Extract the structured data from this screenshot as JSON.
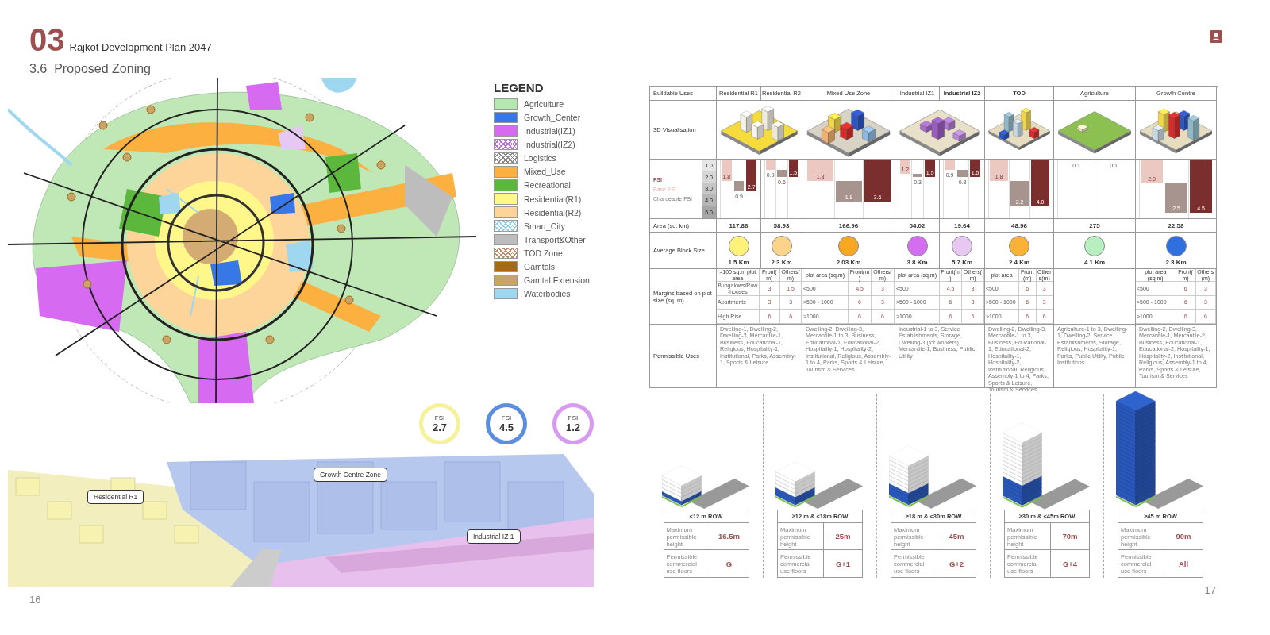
{
  "header": {
    "chapter": "03",
    "document_title": "Rajkot Development Plan 2047",
    "section_title": "3.6  Proposed Zoning"
  },
  "legend": {
    "title": "LEGEND",
    "items": [
      {
        "label": "Agriculture",
        "color": "#b5e8b0",
        "kind": "solid"
      },
      {
        "label": "Growth_Center",
        "color": "#3778e6",
        "kind": "solid"
      },
      {
        "label": "Industrial(IZ1)",
        "color": "#d66af0",
        "kind": "solid"
      },
      {
        "label": "Industrial(IZ2)",
        "color": "#c070e0",
        "kind": "hatched"
      },
      {
        "label": "Logistics",
        "color": "#888888",
        "kind": "hatched"
      },
      {
        "label": "Mixed_Use",
        "color": "#fbb040",
        "kind": "solid"
      },
      {
        "label": "Recreational",
        "color": "#5cb83c",
        "kind": "solid"
      },
      {
        "label": "Residential(R1)",
        "color": "#fff78a",
        "kind": "solid"
      },
      {
        "label": "Residential(R2)",
        "color": "#fdd59a",
        "kind": "solid"
      },
      {
        "label": "Smart_City",
        "color": "#8fd0ea",
        "kind": "hatched"
      },
      {
        "label": "Transport&Other",
        "color": "#bdbdbd",
        "kind": "solid"
      },
      {
        "label": "TOD Zone",
        "color": "#c08a6a",
        "kind": "hatched"
      },
      {
        "label": "Gamtals",
        "color": "#a86a10",
        "kind": "solid"
      },
      {
        "label": "Gamtal Extension",
        "color": "#c9a468",
        "kind": "solid"
      },
      {
        "label": "Waterbodies",
        "color": "#9fd6f0",
        "kind": "solid"
      }
    ]
  },
  "fsi_badges": [
    {
      "label": "FSI",
      "value": "2.7",
      "color": "#f5f29a"
    },
    {
      "label": "FSI",
      "value": "4.5",
      "color": "#5b8ee0"
    },
    {
      "label": "FSI",
      "value": "1.2",
      "color": "#d89af0"
    }
  ],
  "render_callouts": [
    "Residential R1",
    "Growth Centre Zone",
    "Industrial IZ 1"
  ],
  "page_numbers": [
    "16",
    "17"
  ],
  "table": {
    "row_labels": {
      "uses": "Buildable Uses",
      "visualisation": "3D Visualisation",
      "fsi": "FSI",
      "base_fsi": "Base FSI",
      "chargeable_fsi": "Chargeable FSI",
      "area": "Area (sq. km)",
      "block": "Average Block Size",
      "margins": "Margins based on plot size (sq. m)",
      "permissible": "Permissible Uses"
    },
    "fsi_scale": [
      "1.0",
      "2.0",
      "3.0",
      "4.0",
      "5.0"
    ],
    "zone_groups": [
      {
        "kind": "residential",
        "zones": [
          {
            "name": "Residential R1",
            "bold": false,
            "area": "117.86",
            "block_size": "1.5 Km",
            "color": "#fff27a",
            "fsi": [
              {
                "kind": "base",
                "value": "1.8",
                "level": 0.36
              },
              {
                "kind": "chargeable",
                "value": "0.9"
              },
              {
                "kind": "total",
                "value": "2.7",
                "level": 0.54
              }
            ]
          },
          {
            "name": "Residential R2",
            "bold": false,
            "area": "58.93",
            "block_size": "2.3 Km",
            "color": "#fcd38a",
            "fsi": [
              {
                "kind": "base",
                "value": "0.9",
                "level": 0.18
              },
              {
                "kind": "chargeable",
                "value": "0.6"
              },
              {
                "kind": "total",
                "value": "1.5",
                "level": 0.3
              }
            ]
          }
        ],
        "margins": {
          "headers": [
            ">100 sq.m plot area",
            "Front(m)",
            "Others(m)"
          ],
          "rows": [
            [
              "Bungalows/Row-houses",
              "3",
              "1.5"
            ],
            [
              "Apartments",
              "3",
              "3"
            ],
            [
              "High Rise",
              "6",
              "6"
            ]
          ]
        },
        "uses": "Dwelling-1, Dwelling-2, Dwelling-3, Mercantile-1, Business, Educational-1, Religious, Hospitality-1, Institutional, Parks, Assembly-1, Sports & Leisure"
      },
      {
        "kind": "mixed",
        "zones": [
          {
            "name": "Mixed Use Zone",
            "bold": false,
            "area": "166.96",
            "block_size": "2.03 Km",
            "color": "#f7a823",
            "fsi": [
              {
                "kind": "base",
                "value": "1.8",
                "level": 0.36
              },
              {
                "kind": "chargeable",
                "value": "1.8"
              },
              {
                "kind": "total",
                "value": "3.6",
                "level": 0.72
              }
            ]
          }
        ],
        "margins": {
          "headers": [
            "plot area (sq.m)",
            "Front(m)",
            "Others(m)"
          ],
          "rows": [
            [
              "<500",
              "4.5",
              "3"
            ],
            [
              ">500 - 1000",
              "6",
              "3"
            ],
            [
              ">1000",
              "6",
              "6"
            ]
          ]
        },
        "uses": "Dwelling-2, Dwelling-3, Mercantile-1 to 3, Business, Educational-1, Educational-2, Hospitality-1, Hospitality-2, Institutional, Religious, Assembly-1 to 4, Parks, Sports & Leisure, Tourism & Services"
      },
      {
        "kind": "industrial",
        "zones": [
          {
            "name": "Industrial IZ1",
            "bold": false,
            "area": "54.02",
            "block_size": "3.8 Km",
            "color": "#d46ef0",
            "fsi": [
              {
                "kind": "base",
                "value": "1.2",
                "level": 0.24
              },
              {
                "kind": "chargeable",
                "value": "0.3"
              },
              {
                "kind": "total",
                "value": "1.5",
                "level": 0.3
              }
            ]
          },
          {
            "name": "Industrial IZ2",
            "bold": true,
            "area": "19.64",
            "block_size": "5.7 Km",
            "color": "#e6c8f2",
            "fsi": [
              {
                "kind": "base",
                "value": "0.9",
                "level": 0.18
              },
              {
                "kind": "chargeable",
                "value": "0.3"
              },
              {
                "kind": "total",
                "value": "1.5",
                "level": 0.3
              }
            ]
          }
        ],
        "margins": {
          "headers": [
            "plot area (sq.m)",
            "Front(m)",
            "Others(m)"
          ],
          "rows": [
            [
              "<500",
              "4.5",
              "3"
            ],
            [
              ">500 - 1000",
              "6",
              "3"
            ],
            [
              ">1000",
              "6",
              "6"
            ]
          ]
        },
        "uses": "Industrial-1 to 3, Service Establishments, Storage, Dwelling-3 (for workers), Mercantile-1, Business, Public Utility"
      },
      {
        "kind": "tod",
        "zones": [
          {
            "name": "TOD",
            "bold": true,
            "area": "48.96",
            "block_size": "2.4 Km",
            "color": "#f9b233",
            "fsi": [
              {
                "kind": "base",
                "value": "1.8",
                "level": 0.36
              },
              {
                "kind": "chargeable",
                "value": "2.2"
              },
              {
                "kind": "total",
                "value": "4.0",
                "level": 0.8
              }
            ]
          }
        ],
        "margins": {
          "headers": [
            "plot area",
            "Front(m)",
            "Others(m)"
          ],
          "rows": [
            [
              "<500",
              "6",
              "3"
            ],
            [
              ">500 - 1000",
              "6",
              "3"
            ],
            [
              ">1000",
              "6",
              "6"
            ]
          ]
        },
        "uses": "Dwelling-2, Dwelling-3, Mercantile-1 to 3, Business, Educational-1, Educational-2, Hospitality-1, Hospitality-2, Institutional, Religious, Assembly-1 to 4, Parks, Sports & Leisure, Tourism & Services"
      },
      {
        "kind": "agriculture",
        "zones": [
          {
            "name": "Agriculture",
            "bold": false,
            "area": "275",
            "block_size": "4.1 Km",
            "color": "#b7efc0",
            "fsi": [
              {
                "kind": "base",
                "value": "0.1",
                "level": 0.02
              },
              {
                "kind": "total",
                "value": "0.1",
                "level": 0.02
              }
            ]
          }
        ],
        "uses": "Agriculture-1 to 3, Dwelling-1, Dwelling-2, Service Establishments, Storage, Religious, Hospitality-1, Parks, Public Utility, Public Institutions"
      },
      {
        "kind": "growth",
        "zones": [
          {
            "name": "Growth Centre",
            "bold": false,
            "area": "22.58",
            "block_size": "2.3 Km",
            "color": "#2f6fe0",
            "fsi": [
              {
                "kind": "base",
                "value": "2.0",
                "level": 0.4
              },
              {
                "kind": "chargeable",
                "value": "2.5"
              },
              {
                "kind": "total",
                "value": "4.5",
                "level": 0.9
              }
            ]
          }
        ],
        "margins": {
          "headers": [
            "plot area (sq.m)",
            "Front(m)",
            "Others(m)"
          ],
          "rows": [
            [
              "<500",
              "6",
              "3"
            ],
            [
              ">500 - 1000",
              "6",
              "3"
            ],
            [
              ">1000",
              "6",
              "6"
            ]
          ]
        },
        "uses": "Dwelling-2, Dwelling-3, Mercantile-1, Mercantile-2, Business, Educational-1, Educational-2, Hospitality-1, Hospitality-2, Institutional, Religious, Assembly-1 to 4, Parks, Sports & Leisure, Tourism & Services"
      }
    ]
  },
  "row_types": [
    {
      "title": "<12 m ROW",
      "height_label": "Maximum permissible height",
      "height": "16.5m",
      "commercial_label": "Permissible commercial use floors",
      "commercial": "G"
    },
    {
      "title": "≥12 m & <18m ROW",
      "height_label": "Maximum permissible height",
      "height": "25m",
      "commercial_label": "Permissible commercial use floors",
      "commercial": "G+1"
    },
    {
      "title": "≥18 m & <30m ROW",
      "height_label": "Maximum permissible height",
      "height": "45m",
      "commercial_label": "Permissible commercial use floors",
      "commercial": "G+2"
    },
    {
      "title": "≥30 m & <45m ROW",
      "height_label": "Maximum permissible height",
      "height": "70m",
      "commercial_label": "Permissible commercial use floors",
      "commercial": "G+4"
    },
    {
      "title": "≥45 m ROW",
      "height_label": "Maximum permissible height",
      "height": "90m",
      "commercial_label": "Permissible commercial use floors",
      "commercial": "All"
    }
  ]
}
